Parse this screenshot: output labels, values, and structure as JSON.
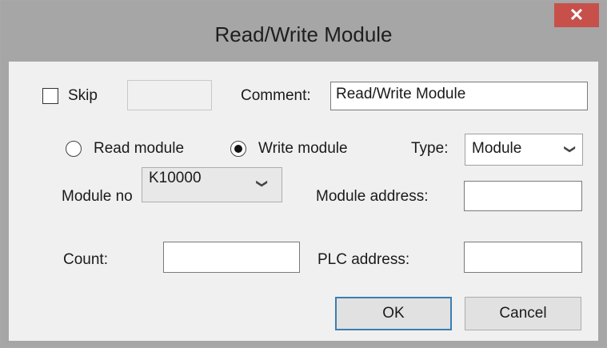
{
  "window": {
    "title": "Read/Write Module",
    "close_glyph": "✕"
  },
  "skip": {
    "label": "Skip",
    "checked": false,
    "value": ""
  },
  "comment": {
    "label": "Comment:",
    "value": "Read/Write Module"
  },
  "mode": {
    "read_label": "Read module",
    "write_label": "Write module",
    "selected": "write"
  },
  "type": {
    "label": "Type:",
    "value": "Module"
  },
  "module_no": {
    "label": "Module no",
    "value": "K10000"
  },
  "module_address": {
    "label": "Module address:",
    "value": ""
  },
  "count": {
    "label": "Count:",
    "value": ""
  },
  "plc_address": {
    "label": "PLC address:",
    "value": ""
  },
  "buttons": {
    "ok": "OK",
    "cancel": "Cancel"
  },
  "icons": {
    "dropdown": "chevron-down-icon",
    "close": "close-icon"
  },
  "colors": {
    "close_button": "#c7504b",
    "focus_border": "#3c7fb1",
    "title_bar": "#a6a6a6"
  }
}
